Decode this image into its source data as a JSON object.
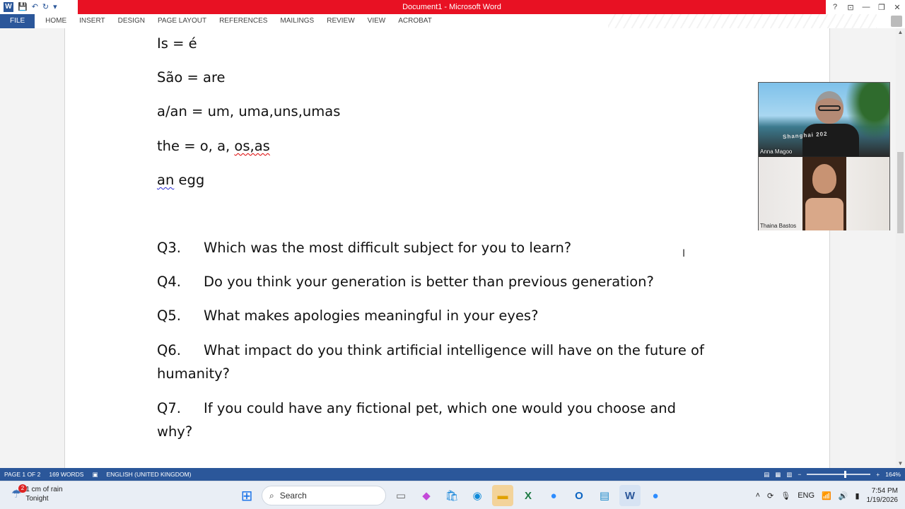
{
  "window": {
    "title": "Document1 - Microsoft Word",
    "app_icon_letter": "W",
    "help": "?",
    "controls": [
      "—",
      "❐",
      "✕"
    ]
  },
  "ribbon": {
    "tabs": [
      "FILE",
      "HOME",
      "INSERT",
      "DESIGN",
      "PAGE LAYOUT",
      "REFERENCES",
      "MAILINGS",
      "REVIEW",
      "VIEW",
      "ACROBAT"
    ]
  },
  "document": {
    "vocab": [
      {
        "text": "Is = é"
      },
      {
        "text": "São = are"
      },
      {
        "text": "a/an = um, uma,uns,umas"
      },
      {
        "prefix": "the = o, a, ",
        "marked": "os,as"
      },
      {
        "marked": "an",
        "suffix": " egg"
      }
    ],
    "questions": [
      {
        "label": "Q3.",
        "text": "Which was the most difficult subject for you to learn?"
      },
      {
        "label": "Q4.",
        "text": "Do you think your generation is better than previous generation?"
      },
      {
        "label": "Q5.",
        "text": "What makes apologies meaningful in your eyes?"
      },
      {
        "label": "Q6.",
        "text": "What impact do you think artificial intelligence will have on the future of",
        "continuation": "humanity?"
      },
      {
        "label": "Q7.",
        "text": "If you could have any fictional pet, which one would you choose and",
        "continuation": "why?"
      }
    ]
  },
  "video": {
    "participants": [
      {
        "name": "Anna Magoo",
        "shirt_text": "Shanghai 202"
      },
      {
        "name": "Thaina Bastos"
      }
    ]
  },
  "statusbar": {
    "page": "PAGE 1 OF 2",
    "words": "169 WORDS",
    "language": "ENGLISH (UNITED KINGDOM)",
    "zoom": "164%"
  },
  "taskbar": {
    "weather": {
      "line1": "1 cm of rain",
      "line2": "Tonight",
      "badge": "2"
    },
    "search_placeholder": "Search",
    "language": "ENG",
    "time": "7:54 PM",
    "date": "1/19/2026"
  },
  "colors": {
    "word_blue": "#2b579a",
    "title_red": "#e81123"
  }
}
